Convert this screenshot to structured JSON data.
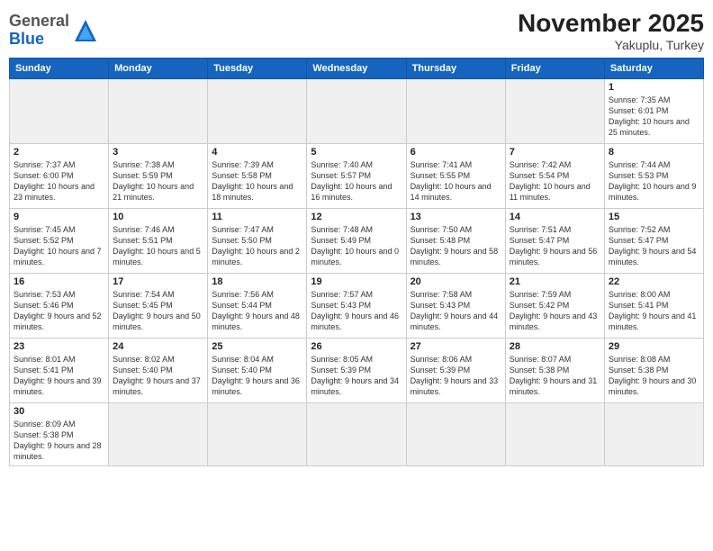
{
  "logo": {
    "general": "General",
    "blue": "Blue"
  },
  "header": {
    "month": "November 2025",
    "location": "Yakuplu, Turkey"
  },
  "weekdays": [
    "Sunday",
    "Monday",
    "Tuesday",
    "Wednesday",
    "Thursday",
    "Friday",
    "Saturday"
  ],
  "weeks": [
    [
      {
        "day": "",
        "empty": true
      },
      {
        "day": "",
        "empty": true
      },
      {
        "day": "",
        "empty": true
      },
      {
        "day": "",
        "empty": true
      },
      {
        "day": "",
        "empty": true
      },
      {
        "day": "",
        "empty": true
      },
      {
        "day": "1",
        "sunrise": "Sunrise: 7:35 AM",
        "sunset": "Sunset: 6:01 PM",
        "daylight": "Daylight: 10 hours and 25 minutes."
      }
    ],
    [
      {
        "day": "2",
        "sunrise": "Sunrise: 7:37 AM",
        "sunset": "Sunset: 6:00 PM",
        "daylight": "Daylight: 10 hours and 23 minutes."
      },
      {
        "day": "3",
        "sunrise": "Sunrise: 7:38 AM",
        "sunset": "Sunset: 5:59 PM",
        "daylight": "Daylight: 10 hours and 21 minutes."
      },
      {
        "day": "4",
        "sunrise": "Sunrise: 7:39 AM",
        "sunset": "Sunset: 5:58 PM",
        "daylight": "Daylight: 10 hours and 18 minutes."
      },
      {
        "day": "5",
        "sunrise": "Sunrise: 7:40 AM",
        "sunset": "Sunset: 5:57 PM",
        "daylight": "Daylight: 10 hours and 16 minutes."
      },
      {
        "day": "6",
        "sunrise": "Sunrise: 7:41 AM",
        "sunset": "Sunset: 5:55 PM",
        "daylight": "Daylight: 10 hours and 14 minutes."
      },
      {
        "day": "7",
        "sunrise": "Sunrise: 7:42 AM",
        "sunset": "Sunset: 5:54 PM",
        "daylight": "Daylight: 10 hours and 11 minutes."
      },
      {
        "day": "8",
        "sunrise": "Sunrise: 7:44 AM",
        "sunset": "Sunset: 5:53 PM",
        "daylight": "Daylight: 10 hours and 9 minutes."
      }
    ],
    [
      {
        "day": "9",
        "sunrise": "Sunrise: 7:45 AM",
        "sunset": "Sunset: 5:52 PM",
        "daylight": "Daylight: 10 hours and 7 minutes."
      },
      {
        "day": "10",
        "sunrise": "Sunrise: 7:46 AM",
        "sunset": "Sunset: 5:51 PM",
        "daylight": "Daylight: 10 hours and 5 minutes."
      },
      {
        "day": "11",
        "sunrise": "Sunrise: 7:47 AM",
        "sunset": "Sunset: 5:50 PM",
        "daylight": "Daylight: 10 hours and 2 minutes."
      },
      {
        "day": "12",
        "sunrise": "Sunrise: 7:48 AM",
        "sunset": "Sunset: 5:49 PM",
        "daylight": "Daylight: 10 hours and 0 minutes."
      },
      {
        "day": "13",
        "sunrise": "Sunrise: 7:50 AM",
        "sunset": "Sunset: 5:48 PM",
        "daylight": "Daylight: 9 hours and 58 minutes."
      },
      {
        "day": "14",
        "sunrise": "Sunrise: 7:51 AM",
        "sunset": "Sunset: 5:47 PM",
        "daylight": "Daylight: 9 hours and 56 minutes."
      },
      {
        "day": "15",
        "sunrise": "Sunrise: 7:52 AM",
        "sunset": "Sunset: 5:47 PM",
        "daylight": "Daylight: 9 hours and 54 minutes."
      }
    ],
    [
      {
        "day": "16",
        "sunrise": "Sunrise: 7:53 AM",
        "sunset": "Sunset: 5:46 PM",
        "daylight": "Daylight: 9 hours and 52 minutes."
      },
      {
        "day": "17",
        "sunrise": "Sunrise: 7:54 AM",
        "sunset": "Sunset: 5:45 PM",
        "daylight": "Daylight: 9 hours and 50 minutes."
      },
      {
        "day": "18",
        "sunrise": "Sunrise: 7:56 AM",
        "sunset": "Sunset: 5:44 PM",
        "daylight": "Daylight: 9 hours and 48 minutes."
      },
      {
        "day": "19",
        "sunrise": "Sunrise: 7:57 AM",
        "sunset": "Sunset: 5:43 PM",
        "daylight": "Daylight: 9 hours and 46 minutes."
      },
      {
        "day": "20",
        "sunrise": "Sunrise: 7:58 AM",
        "sunset": "Sunset: 5:43 PM",
        "daylight": "Daylight: 9 hours and 44 minutes."
      },
      {
        "day": "21",
        "sunrise": "Sunrise: 7:59 AM",
        "sunset": "Sunset: 5:42 PM",
        "daylight": "Daylight: 9 hours and 43 minutes."
      },
      {
        "day": "22",
        "sunrise": "Sunrise: 8:00 AM",
        "sunset": "Sunset: 5:41 PM",
        "daylight": "Daylight: 9 hours and 41 minutes."
      }
    ],
    [
      {
        "day": "23",
        "sunrise": "Sunrise: 8:01 AM",
        "sunset": "Sunset: 5:41 PM",
        "daylight": "Daylight: 9 hours and 39 minutes."
      },
      {
        "day": "24",
        "sunrise": "Sunrise: 8:02 AM",
        "sunset": "Sunset: 5:40 PM",
        "daylight": "Daylight: 9 hours and 37 minutes."
      },
      {
        "day": "25",
        "sunrise": "Sunrise: 8:04 AM",
        "sunset": "Sunset: 5:40 PM",
        "daylight": "Daylight: 9 hours and 36 minutes."
      },
      {
        "day": "26",
        "sunrise": "Sunrise: 8:05 AM",
        "sunset": "Sunset: 5:39 PM",
        "daylight": "Daylight: 9 hours and 34 minutes."
      },
      {
        "day": "27",
        "sunrise": "Sunrise: 8:06 AM",
        "sunset": "Sunset: 5:39 PM",
        "daylight": "Daylight: 9 hours and 33 minutes."
      },
      {
        "day": "28",
        "sunrise": "Sunrise: 8:07 AM",
        "sunset": "Sunset: 5:38 PM",
        "daylight": "Daylight: 9 hours and 31 minutes."
      },
      {
        "day": "29",
        "sunrise": "Sunrise: 8:08 AM",
        "sunset": "Sunset: 5:38 PM",
        "daylight": "Daylight: 9 hours and 30 minutes."
      }
    ],
    [
      {
        "day": "30",
        "sunrise": "Sunrise: 8:09 AM",
        "sunset": "Sunset: 5:38 PM",
        "daylight": "Daylight: 9 hours and 28 minutes."
      },
      {
        "day": "",
        "empty": true
      },
      {
        "day": "",
        "empty": true
      },
      {
        "day": "",
        "empty": true
      },
      {
        "day": "",
        "empty": true
      },
      {
        "day": "",
        "empty": true
      },
      {
        "day": "",
        "empty": true
      }
    ]
  ]
}
